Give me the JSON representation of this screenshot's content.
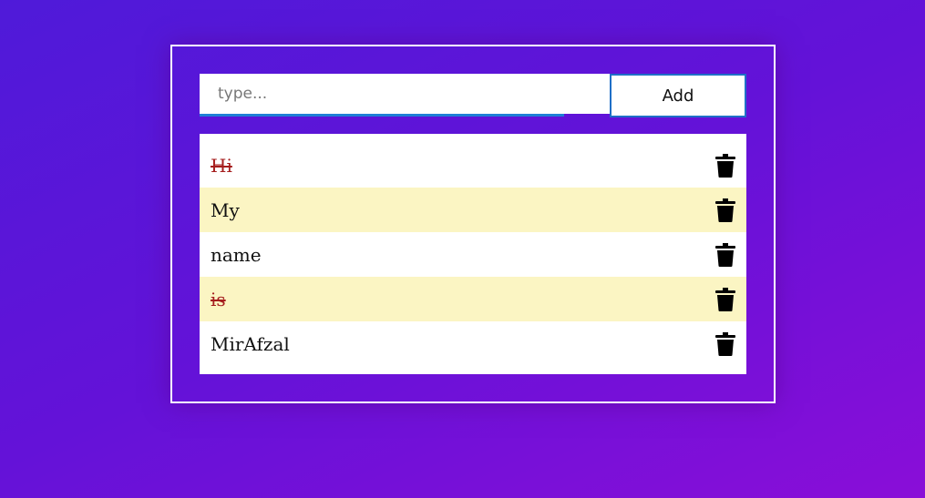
{
  "input": {
    "value": "",
    "placeholder": "type..."
  },
  "add_button": {
    "label": "Add"
  },
  "items": [
    {
      "text": "Hi",
      "done": true,
      "icon": "trash-icon"
    },
    {
      "text": "My",
      "done": false,
      "icon": "trash-icon"
    },
    {
      "text": "name",
      "done": false,
      "icon": "trash-icon"
    },
    {
      "text": "is",
      "done": true,
      "icon": "trash-icon"
    },
    {
      "text": "MirAfzal",
      "done": false,
      "icon": "trash-icon"
    }
  ],
  "colors": {
    "background_start": "#4f1ad9",
    "background_end": "#8a0ed8",
    "accent": "#1f7fd6",
    "alt_row": "#fbf5c3",
    "done_text": "#a51d1d"
  }
}
